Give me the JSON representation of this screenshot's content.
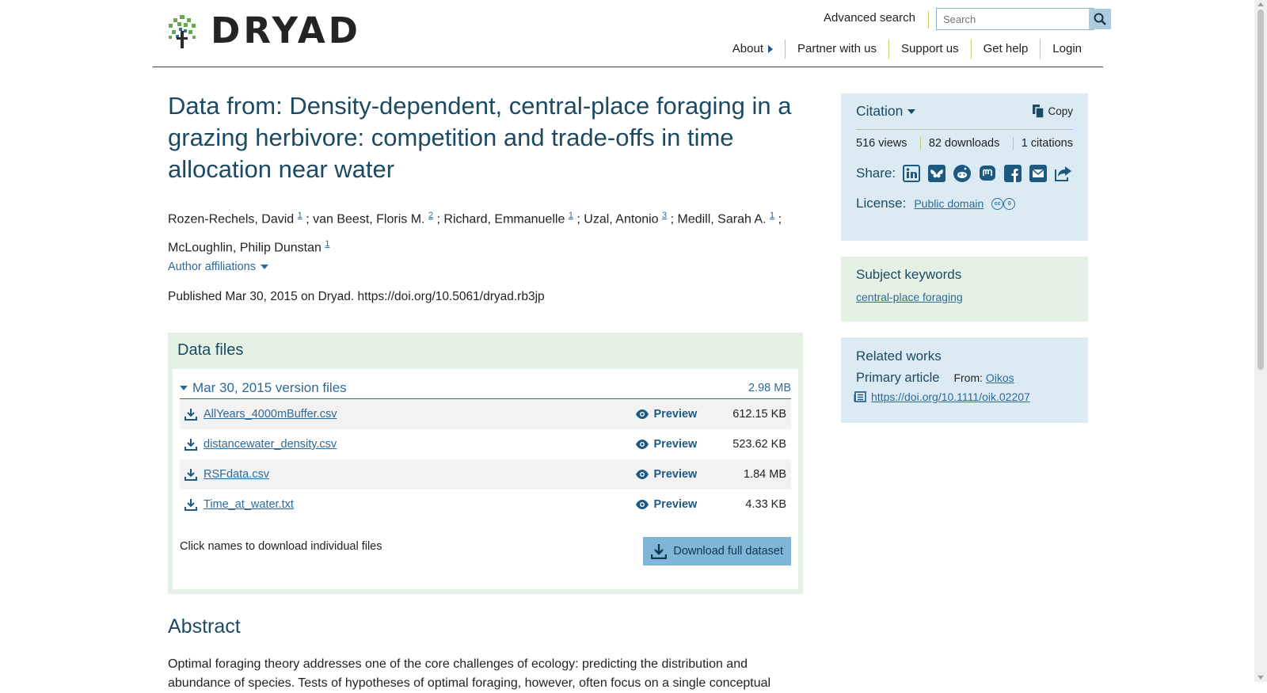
{
  "header": {
    "logo_text": "DRYAD",
    "advanced_search": "Advanced search",
    "search_placeholder": "Search",
    "nav": [
      "About",
      "Partner with us",
      "Support us",
      "Get help",
      "Login"
    ]
  },
  "dataset": {
    "title": "Data from: Density-dependent, central-place foraging in a grazing herbivore: competition and trade-offs in time allocation near water",
    "authors": [
      {
        "name": "Rozen-Rechels, David",
        "aff": "1"
      },
      {
        "name": "van Beest, Floris M.",
        "aff": "2"
      },
      {
        "name": "Richard, Emmanuelle",
        "aff": "1"
      },
      {
        "name": "Uzal, Antonio",
        "aff": "3"
      },
      {
        "name": "Medill, Sarah A.",
        "aff": "1"
      },
      {
        "name": "McLoughlin, Philip Dunstan",
        "aff": "1"
      }
    ],
    "author_separator": "; ",
    "affiliations_toggle": "Author affiliations",
    "published": "Published Mar 30, 2015 on Dryad. https://doi.org/10.5061/dryad.rb3jp"
  },
  "data_files": {
    "heading": "Data files",
    "version_label": "Mar 30, 2015 version files",
    "version_size": "2.98 MB",
    "preview_label": "Preview",
    "files": [
      {
        "name": "AllYears_4000mBuffer.csv",
        "size": "612.15 KB"
      },
      {
        "name": "distancewater_density.csv",
        "size": "523.62 KB"
      },
      {
        "name": "RSFdata.csv",
        "size": "1.84 MB"
      },
      {
        "name": "Time_at_water.txt",
        "size": "4.33 KB"
      }
    ],
    "note": "Click names to download individual files",
    "download_full": "Download full dataset"
  },
  "abstract": {
    "heading": "Abstract",
    "text": "Optimal foraging theory addresses one of the core challenges of ecology: predicting the distribution and abundance of species. Tests of hypotheses of optimal foraging, however, often focus on a single conceptual"
  },
  "sidebar": {
    "citation": {
      "title": "Citation",
      "copy": "Copy",
      "views": "516 views",
      "downloads": "82 downloads",
      "citations": "1 citations",
      "share_label": "Share:",
      "share_icons": [
        "linkedin-icon",
        "bluesky-icon",
        "reddit-icon",
        "mastodon-icon",
        "facebook-icon",
        "email-icon",
        "share-icon"
      ],
      "license_label": "License:",
      "license_value": "Public domain"
    },
    "keywords": {
      "title": "Subject keywords",
      "items": [
        "central-place foraging"
      ]
    },
    "related": {
      "title": "Related works",
      "type": "Primary article",
      "from_label": "From:",
      "from_value": "Oikos",
      "doi": "https://doi.org/10.1111/oik.02207"
    }
  },
  "colors": {
    "title_blue": "#1c4a63",
    "link_blue": "#2d6a9a",
    "green_panel": "#e6f1e5",
    "blue_panel": "#dcebf3",
    "download_button": "#7fb5d6",
    "divider_olive": "#c9c76c"
  }
}
